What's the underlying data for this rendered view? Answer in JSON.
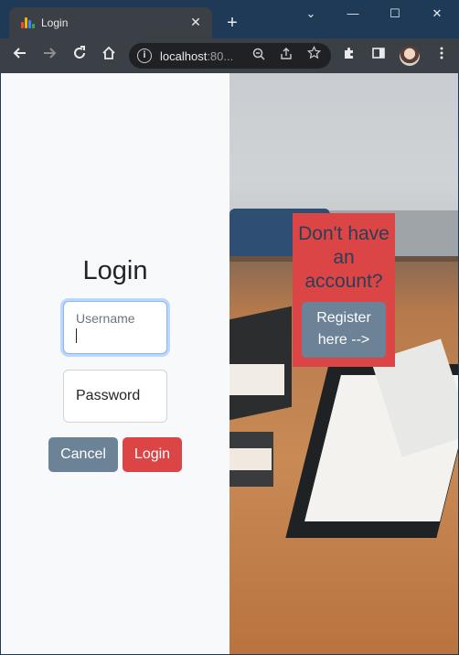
{
  "browser": {
    "tab_title": "Login",
    "tab_close": "✕",
    "new_tab": "+",
    "url_host": "localhost",
    "url_rest": ":80...",
    "controls": {
      "dropdown": "⌄",
      "minimize": "—",
      "maximize": "☐",
      "close": "✕"
    }
  },
  "page": {
    "title": "Login",
    "username_label": "Username",
    "password_placeholder": "Password",
    "cancel_label": "Cancel",
    "login_label": "Login",
    "cta_text": "Don't have an account?",
    "register_label": "Register here -->"
  },
  "colors": {
    "accent_red": "#dc4545",
    "slate": "#6c8296",
    "frame": "#1e3a56"
  }
}
